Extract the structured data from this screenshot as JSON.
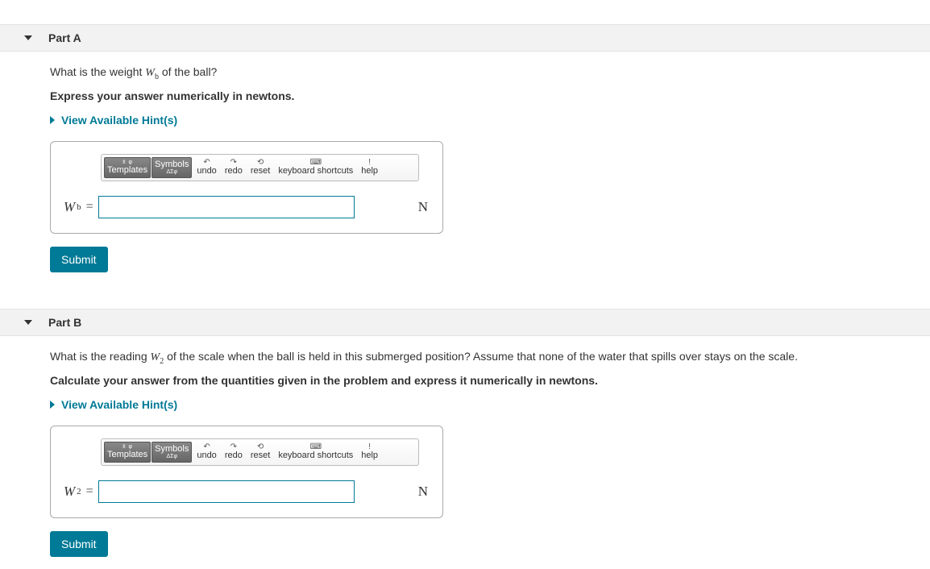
{
  "partA": {
    "title": "Part A",
    "question_prefix": "What is the weight ",
    "question_var": "W",
    "question_sub": "b",
    "question_suffix": " of the ball?",
    "instruction": "Express your answer numerically in newtons.",
    "hints_label": "View Available Hint(s)",
    "toolbar": {
      "templates": "Templates",
      "symbols": "Symbols",
      "undo": "undo",
      "redo": "redo",
      "reset": "reset",
      "keyboard": "keyboard shortcuts",
      "help": "help"
    },
    "var": "W",
    "sub": "b",
    "equals": "=",
    "value": "",
    "unit": "N",
    "submit": "Submit"
  },
  "partB": {
    "title": "Part B",
    "question_prefix": "What is the reading ",
    "question_var": "W",
    "question_sub": "2",
    "question_suffix": " of the scale when the ball is held in this submerged position? Assume that none of the water that spills over stays on the scale.",
    "instruction": "Calculate your answer from the quantities given in the problem and express it numerically in newtons.",
    "hints_label": "View Available Hint(s)",
    "toolbar": {
      "templates": "Templates",
      "symbols": "Symbols",
      "undo": "undo",
      "redo": "redo",
      "reset": "reset",
      "keyboard": "keyboard shortcuts",
      "help": "help"
    },
    "var": "W",
    "sub": "2",
    "equals": "=",
    "value": "",
    "unit": "N",
    "submit": "Submit"
  }
}
